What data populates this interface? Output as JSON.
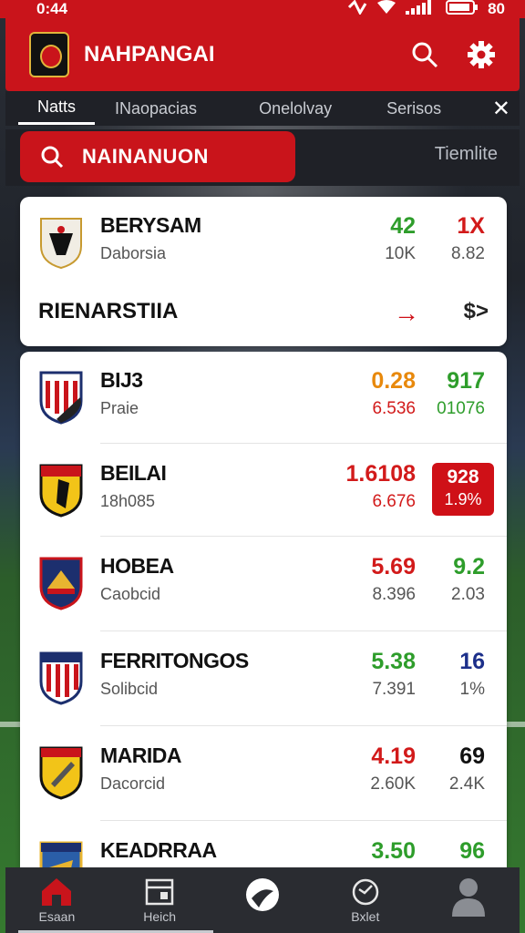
{
  "status_bar": {
    "time": "0:44",
    "battery_text": "80"
  },
  "header": {
    "title": "NAHPANGAI"
  },
  "tabs": [
    {
      "label": "Natts",
      "active": true
    },
    {
      "label": "INaopacias",
      "active": false
    },
    {
      "label": "Onelolvay",
      "active": false
    },
    {
      "label": "Serisos",
      "active": false
    }
  ],
  "search": {
    "value": "NAINANUON",
    "timeline_label": "Tiemlite"
  },
  "featured": {
    "name": "BERYSAM",
    "sub": "Daborsia",
    "v1": "42",
    "v1_sub": "10K",
    "v2": "1X",
    "v2_sub": "8.82",
    "section_label": "RIENARSTIIA",
    "arrow1": "→",
    "arrow2": "$>"
  },
  "teams": [
    {
      "name": "BIJ3",
      "sub": "Praie",
      "v1": "0.28",
      "v1_sub": "6.536",
      "v2": "917",
      "v2_sub": "01076",
      "v1_color": "#e8890c",
      "v2_color": "#2e9d2b",
      "v1sub_color": "#d21a1a",
      "v2sub_color": "#2e9d2b",
      "crest": "stripes-red"
    },
    {
      "name": "BEILAI",
      "sub": "18h085",
      "v1": "1.6108",
      "v1_sub": "6.676",
      "v2": "928",
      "v2_sub": "1.9%",
      "v1_color": "#d21a1a",
      "v1sub_color": "#d21a1a",
      "badge": true,
      "crest": "yellow-black"
    },
    {
      "name": "HOBEA",
      "sub": "Caobcid",
      "v1": "5.69",
      "v1_sub": "8.396",
      "v2": "9.2",
      "v2_sub": "2.03",
      "v1_color": "#d21a1a",
      "v2_color": "#2e9d2b",
      "v1sub_color": "#555555",
      "v2sub_color": "#555555",
      "crest": "navy-gold"
    },
    {
      "name": "FERRITONGOS",
      "sub": "Solibcid",
      "v1": "5.38",
      "v1_sub": "7.391",
      "v2": "16",
      "v2_sub": "1%",
      "v1_color": "#2e9d2b",
      "v2_color": "#1c2f8a",
      "v1sub_color": "#555555",
      "v2sub_color": "#555555",
      "crest": "stripes-navy"
    },
    {
      "name": "MARIDA",
      "sub": "Dacorcid",
      "v1": "4.19",
      "v1_sub": "2.60K",
      "v2": "69",
      "v2_sub": "2.4K",
      "v1_color": "#d21a1a",
      "v2_color": "#111111",
      "v1sub_color": "#555555",
      "v2sub_color": "#555555",
      "crest": "yellow-red"
    },
    {
      "name": "KEADRRAA",
      "sub": "",
      "v1": "3.50",
      "v1_sub": "",
      "v2": "96",
      "v2_sub": "",
      "v1_color": "#2e9d2b",
      "v2_color": "#2e9d2b",
      "v1sub_color": "#555555",
      "v2sub_color": "#555555",
      "crest": "navy-blue"
    }
  ],
  "bottom_nav": [
    {
      "label": "Esaan",
      "icon": "home-icon"
    },
    {
      "label": "Heich",
      "icon": "calendar-icon"
    },
    {
      "label": "",
      "icon": "ball-icon"
    },
    {
      "label": "Bxlet",
      "icon": "refresh-icon"
    },
    {
      "label": "",
      "icon": "profile-icon"
    }
  ],
  "colors": {
    "brand": "#c9141b",
    "card": "#ffffff",
    "nav": "#2a2c31"
  }
}
